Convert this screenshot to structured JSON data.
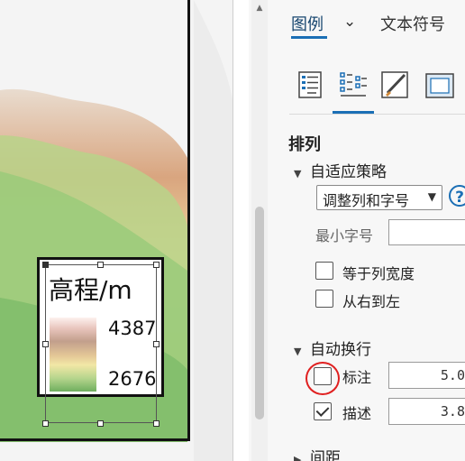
{
  "map": {
    "legend": {
      "title": "高程/m",
      "high_label": "4387",
      "low_label": "2676",
      "ramp_colors": [
        "#fdf1ee",
        "#e8c4bc",
        "#c29f8c",
        "#e4c897",
        "#f2e7a6",
        "#b6d58d",
        "#6fae5e"
      ]
    }
  },
  "panel": {
    "tabs": [
      {
        "label": "图例",
        "active": true
      },
      {
        "label": "文本符号",
        "active": false
      }
    ],
    "toolbar": [
      {
        "icon": "legend-options-icon",
        "active": false
      },
      {
        "icon": "arrangement-icon",
        "active": true
      },
      {
        "icon": "brush-icon",
        "active": false
      },
      {
        "icon": "display-frame-icon",
        "active": false
      }
    ],
    "section_title": "排列",
    "fitting": {
      "header": "自适应策略",
      "strategy_value": "调整列和字号",
      "help_icon": "help-icon",
      "min_font_label": "最小字号",
      "min_font_value": "",
      "equal_column_label": "等于列宽度",
      "equal_column_checked": false,
      "right_to_left_label": "从右到左",
      "right_to_left_checked": false
    },
    "wrap": {
      "header": "自动换行",
      "label_text": "标注",
      "label_checked": false,
      "label_value": "5.0",
      "desc_text": "描述",
      "desc_checked": true,
      "desc_value": "3.8"
    },
    "spacing": {
      "header": "间距"
    },
    "accent_color": "#1b6fb5",
    "highlight_color": "#e02020"
  }
}
